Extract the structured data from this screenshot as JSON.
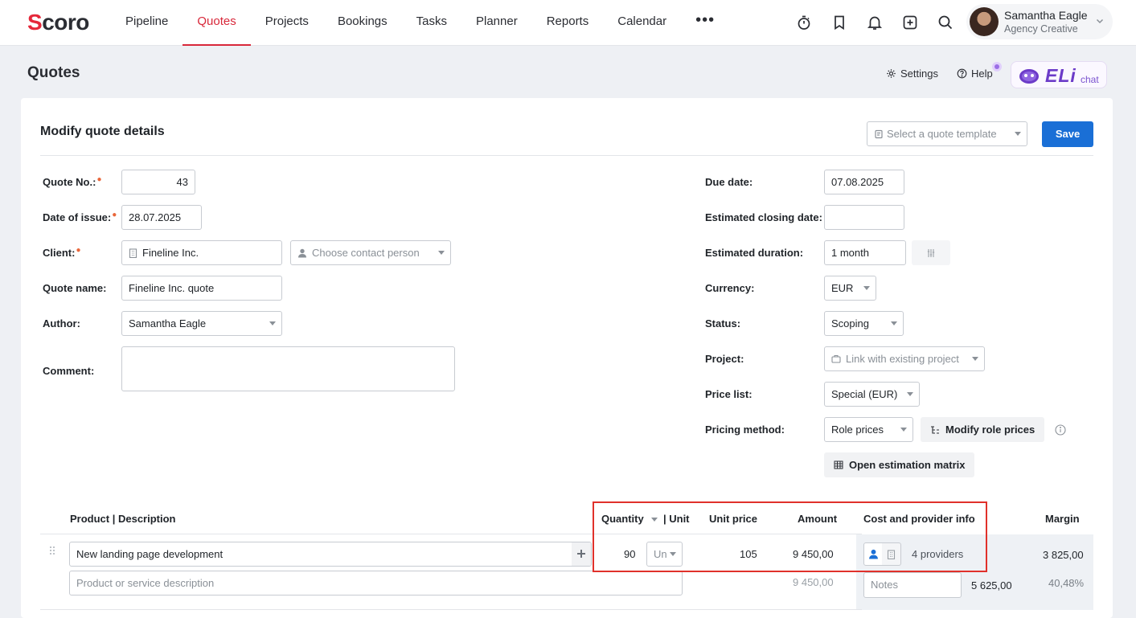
{
  "brand": {
    "logo_s": "S",
    "logo_rest": "coro"
  },
  "nav": {
    "items": [
      {
        "label": "Pipeline",
        "active": false
      },
      {
        "label": "Quotes",
        "active": true
      },
      {
        "label": "Projects",
        "active": false
      },
      {
        "label": "Bookings",
        "active": false
      },
      {
        "label": "Tasks",
        "active": false
      },
      {
        "label": "Planner",
        "active": false
      },
      {
        "label": "Reports",
        "active": false
      },
      {
        "label": "Calendar",
        "active": false
      }
    ],
    "more": "•••"
  },
  "user": {
    "name": "Samantha Eagle",
    "org": "Agency Creative"
  },
  "page": {
    "title": "Quotes",
    "settings": "Settings",
    "help": "Help",
    "eli_brand": "ELi",
    "eli_chat": "chat"
  },
  "card": {
    "title": "Modify quote details",
    "template_placeholder": "Select a quote template",
    "save": "Save"
  },
  "form": {
    "quote_no": {
      "label": "Quote No.:",
      "value": "43"
    },
    "date_of_issue": {
      "label": "Date of issue:",
      "value": "28.07.2025"
    },
    "client": {
      "label": "Client:",
      "value": "Fineline Inc.",
      "contact_placeholder": "Choose contact person"
    },
    "quote_name": {
      "label": "Quote name:",
      "value": "Fineline Inc. quote"
    },
    "author": {
      "label": "Author:",
      "value": "Samantha Eagle"
    },
    "comment": {
      "label": "Comment:",
      "value": ""
    },
    "due_date": {
      "label": "Due date:",
      "value": "07.08.2025"
    },
    "closing_date": {
      "label": "Estimated closing date:",
      "value": ""
    },
    "duration": {
      "label": "Estimated duration:",
      "value": "1 month"
    },
    "currency": {
      "label": "Currency:",
      "value": "EUR"
    },
    "status": {
      "label": "Status:",
      "value": "Scoping"
    },
    "project": {
      "label": "Project:",
      "placeholder": "Link with existing project"
    },
    "price_list": {
      "label": "Price list:",
      "value": "Special (EUR)"
    },
    "pricing_method": {
      "label": "Pricing method:",
      "value": "Role prices",
      "modify_button": "Modify role prices"
    },
    "estimation_matrix": "Open estimation matrix"
  },
  "table": {
    "headers": {
      "product": "Product | Description",
      "quantity": "Quantity",
      "unit": "| Unit",
      "unit_price": "Unit price",
      "amount": "Amount",
      "cost": "Cost and provider info",
      "margin": "Margin"
    },
    "row": {
      "product": "New landing page development",
      "description_placeholder": "Product or service description",
      "quantity": "90",
      "unit": "Un",
      "unit_price": "105",
      "amount": "9 450,00",
      "amount_sub": "9 450,00",
      "providers": "4 providers",
      "notes_placeholder": "Notes",
      "cost": "5 625,00",
      "margin": "3 825,00",
      "margin_pct": "40,48%"
    }
  },
  "colors": {
    "accent": "#d8283a",
    "primary": "#1a6fd6",
    "highlight": "#e0312b",
    "eli": "#6c3bc8"
  }
}
